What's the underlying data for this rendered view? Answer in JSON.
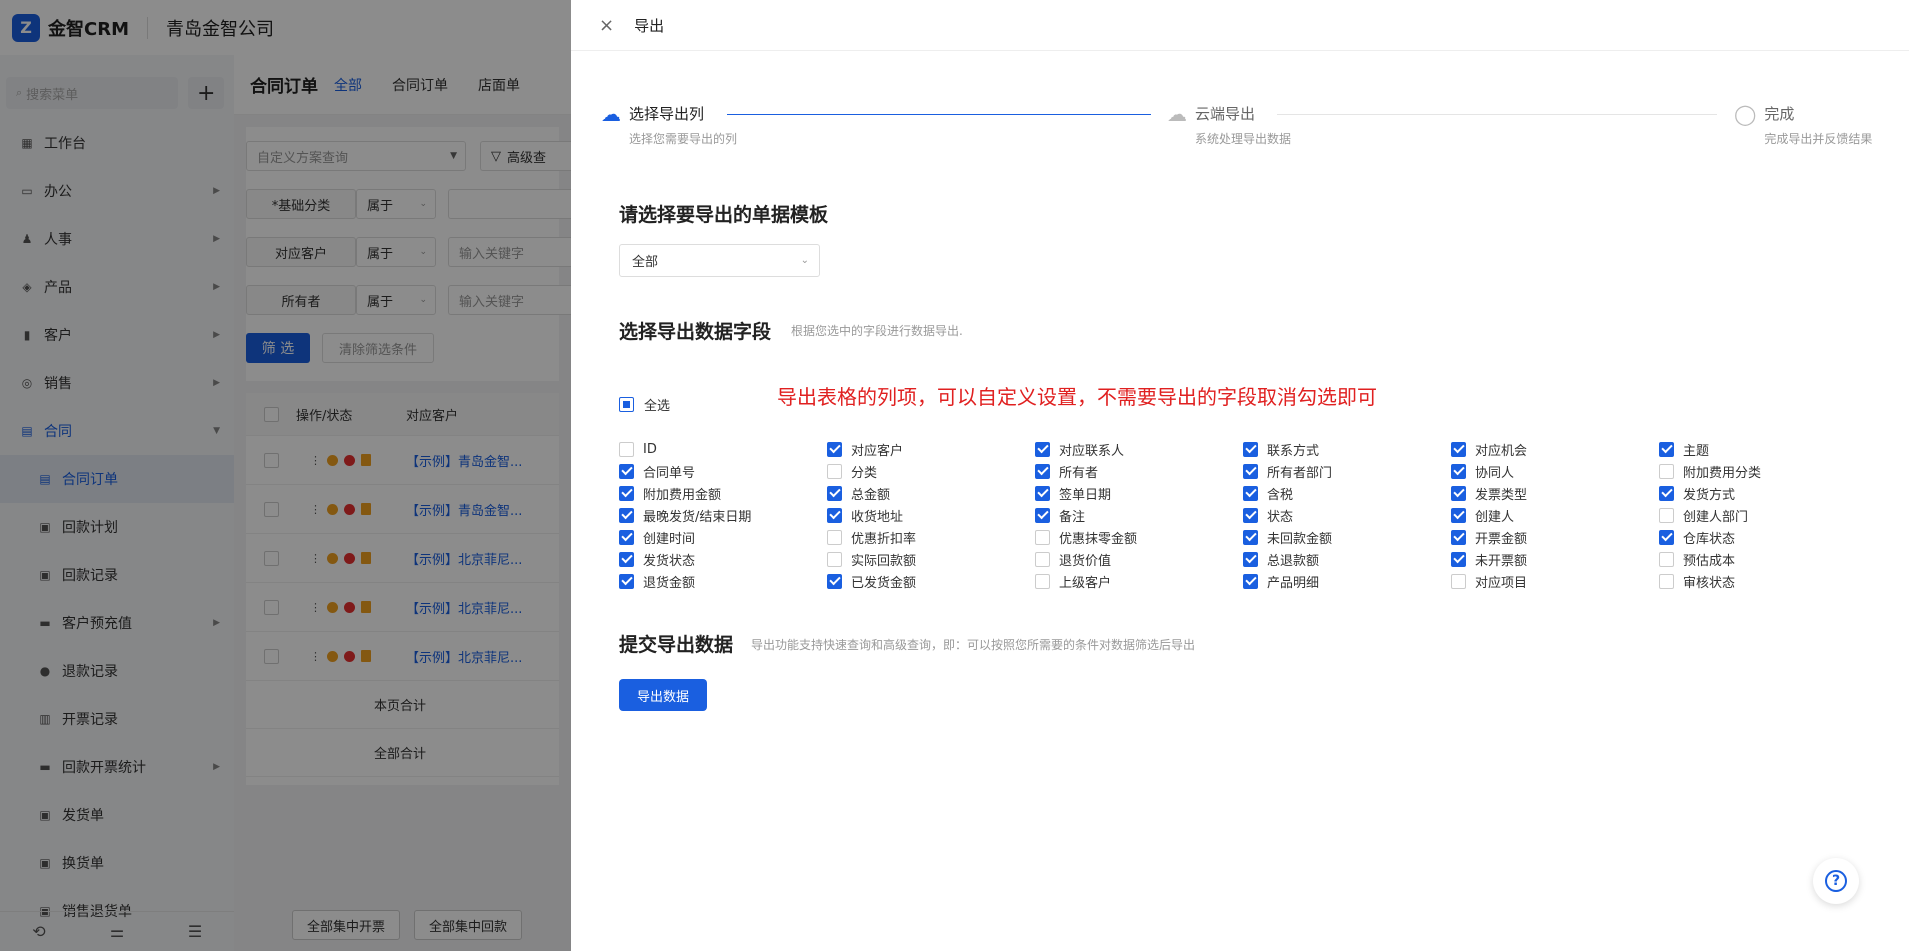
{
  "app": {
    "logo_glyph": "Z",
    "name": "金智CRM",
    "company": "青岛金智公司"
  },
  "sidebar": {
    "search_placeholder": "搜索菜单",
    "add_label": "+",
    "items": [
      {
        "label": "工作台",
        "icon": "dashboard-icon",
        "glyph": "▦",
        "has_arrow": false
      },
      {
        "label": "办公",
        "icon": "monitor-icon",
        "glyph": "▭",
        "has_arrow": true
      },
      {
        "label": "人事",
        "icon": "people-icon",
        "glyph": "♟",
        "has_arrow": true
      },
      {
        "label": "产品",
        "icon": "box-icon",
        "glyph": "◈",
        "has_arrow": true
      },
      {
        "label": "客户",
        "icon": "chart-icon",
        "glyph": "▮",
        "has_arrow": true
      },
      {
        "label": "销售",
        "icon": "target-icon",
        "glyph": "◎",
        "has_arrow": true
      },
      {
        "label": "合同",
        "icon": "contract-icon",
        "glyph": "▤",
        "has_arrow": true,
        "active": true
      }
    ],
    "subitems": [
      {
        "label": "合同订单",
        "icon": "order-icon",
        "glyph": "▤",
        "active": true
      },
      {
        "label": "回款计划",
        "icon": "plan-icon",
        "glyph": "▣"
      },
      {
        "label": "回款记录",
        "icon": "record-icon",
        "glyph": "▣"
      },
      {
        "label": "客户预充值",
        "icon": "folder-icon",
        "glyph": "▬",
        "has_arrow": true
      },
      {
        "label": "退款记录",
        "icon": "refund-icon",
        "glyph": "●"
      },
      {
        "label": "开票记录",
        "icon": "invoice-icon",
        "glyph": "▥"
      },
      {
        "label": "回款开票统计",
        "icon": "folder-icon",
        "glyph": "▬",
        "has_arrow": true
      },
      {
        "label": "发货单",
        "icon": "shipping-icon",
        "glyph": "▣"
      },
      {
        "label": "换货单",
        "icon": "exchange-icon",
        "glyph": "▣"
      },
      {
        "label": "销售退货单",
        "icon": "return-icon",
        "glyph": "▣"
      }
    ],
    "bottom_icons": [
      "history-icon",
      "settings-sliders-icon",
      "collapse-icon"
    ]
  },
  "main": {
    "title": "合同订单",
    "tabs": [
      {
        "label": "全部",
        "active": true
      },
      {
        "label": "合同订单"
      },
      {
        "label": "店面单"
      }
    ],
    "filter": {
      "scheme_placeholder": "自定义方案查询",
      "advanced_label": "高级查",
      "rows": [
        {
          "label": "*基础分类",
          "op": "属于",
          "input": ""
        },
        {
          "label": "对应客户",
          "op": "属于",
          "input": "输入关键字"
        },
        {
          "label": "所有者",
          "op": "属于",
          "input": "输入关键字"
        }
      ],
      "filter_btn": "筛 选",
      "clear_btn": "清除筛选条件"
    },
    "table": {
      "headers": [
        "操作/状态",
        "对应客户"
      ],
      "rows": [
        "【示例】青岛金智...",
        "【示例】青岛金智...",
        "【示例】北京菲尼...",
        "【示例】北京菲尼...",
        "【示例】北京菲尼..."
      ],
      "page_total": "本页合计",
      "all_total": "全部合计"
    },
    "bottom_buttons": [
      "全部集中开票",
      "全部集中回款"
    ]
  },
  "drawer": {
    "close": "×",
    "title": "导出",
    "steps": [
      {
        "title": "选择导出列",
        "desc": "选择您需要导出的列",
        "active": true
      },
      {
        "title": "云端导出",
        "desc": "系统处理导出数据"
      },
      {
        "title": "完成",
        "desc": "完成导出并反馈结果"
      }
    ],
    "template_section": {
      "title": "请选择要导出的单据模板",
      "selected": "全部"
    },
    "fields_section": {
      "title": "选择导出数据字段",
      "desc": "根据您选中的字段进行数据导出."
    },
    "annotation": "导出表格的列项，可以自定义设置，不需要导出的字段取消勾选即可",
    "select_all": "全选",
    "fields": [
      {
        "label": "ID",
        "checked": false
      },
      {
        "label": "对应客户",
        "checked": true
      },
      {
        "label": "对应联系人",
        "checked": true
      },
      {
        "label": "联系方式",
        "checked": true
      },
      {
        "label": "对应机会",
        "checked": true
      },
      {
        "label": "主题",
        "checked": true
      },
      {
        "label": "合同单号",
        "checked": true
      },
      {
        "label": "分类",
        "checked": false
      },
      {
        "label": "所有者",
        "checked": true
      },
      {
        "label": "所有者部门",
        "checked": true
      },
      {
        "label": "协同人",
        "checked": true
      },
      {
        "label": "附加费用分类",
        "checked": false
      },
      {
        "label": "附加费用金额",
        "checked": true
      },
      {
        "label": "总金额",
        "checked": true
      },
      {
        "label": "签单日期",
        "checked": true
      },
      {
        "label": "含税",
        "checked": true
      },
      {
        "label": "发票类型",
        "checked": true
      },
      {
        "label": "发货方式",
        "checked": true
      },
      {
        "label": "最晚发货/结束日期",
        "checked": true
      },
      {
        "label": "收货地址",
        "checked": true
      },
      {
        "label": "备注",
        "checked": true
      },
      {
        "label": "状态",
        "checked": true
      },
      {
        "label": "创建人",
        "checked": true
      },
      {
        "label": "创建人部门",
        "checked": false
      },
      {
        "label": "创建时间",
        "checked": true
      },
      {
        "label": "优惠折扣率",
        "checked": false
      },
      {
        "label": "优惠抹零金额",
        "checked": false
      },
      {
        "label": "未回款金额",
        "checked": true
      },
      {
        "label": "开票金额",
        "checked": true
      },
      {
        "label": "仓库状态",
        "checked": true
      },
      {
        "label": "发货状态",
        "checked": true
      },
      {
        "label": "实际回款额",
        "checked": false
      },
      {
        "label": "退货价值",
        "checked": false
      },
      {
        "label": "总退款额",
        "checked": true
      },
      {
        "label": "未开票额",
        "checked": true
      },
      {
        "label": "预估成本",
        "checked": false
      },
      {
        "label": "退货金额",
        "checked": true
      },
      {
        "label": "已发货金额",
        "checked": true
      },
      {
        "label": "上级客户",
        "checked": false
      },
      {
        "label": "产品明细",
        "checked": true
      },
      {
        "label": "对应项目",
        "checked": false
      },
      {
        "label": "审核状态",
        "checked": false
      }
    ],
    "submit_section": {
      "title": "提交导出数据",
      "desc": "导出功能支持快速查询和高级查询，即：可以按照您所需要的条件对数据筛选后导出"
    },
    "export_btn": "导出数据",
    "help": "?"
  },
  "colors": {
    "accent": "#1a5fe0",
    "annotation": "#e02020"
  }
}
